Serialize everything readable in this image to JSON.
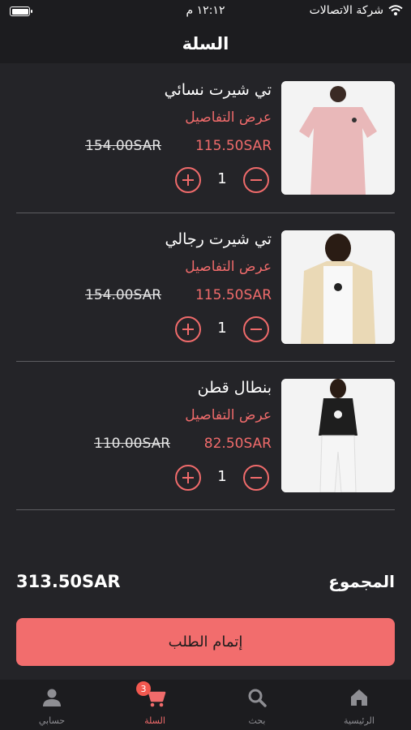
{
  "status_bar": {
    "carrier": "شركة الاتصالات",
    "time": "١٢:١٢ م"
  },
  "header": {
    "title": "السلة"
  },
  "cart": {
    "items": [
      {
        "name": "تي شيرت نسائي",
        "details_link": "عرض التفاصيل",
        "price": "115.50SAR",
        "old_price": "154.00SAR",
        "quantity": "1"
      },
      {
        "name": "تي شيرت رجالي",
        "details_link": "عرض التفاصيل",
        "price": "115.50SAR",
        "old_price": "154.00SAR",
        "quantity": "1"
      },
      {
        "name": "بنطال قطن",
        "details_link": "عرض التفاصيل",
        "price": "82.50SAR",
        "old_price": "110.00SAR",
        "quantity": "1"
      }
    ],
    "total_label": "المجموع",
    "total_value": "313.50SAR",
    "checkout_label": "إتمام الطلب"
  },
  "tabbar": {
    "tabs": [
      {
        "label": "الرئيسية",
        "icon": "home-icon"
      },
      {
        "label": "بحث",
        "icon": "search-icon"
      },
      {
        "label": "السلة",
        "icon": "cart-icon",
        "badge": "3",
        "active": true
      },
      {
        "label": "حسابي",
        "icon": "profile-icon"
      }
    ]
  },
  "colors": {
    "accent": "#f06b6b",
    "background": "#242428",
    "bar": "#1c1c1f",
    "badge": "#f2584f"
  }
}
